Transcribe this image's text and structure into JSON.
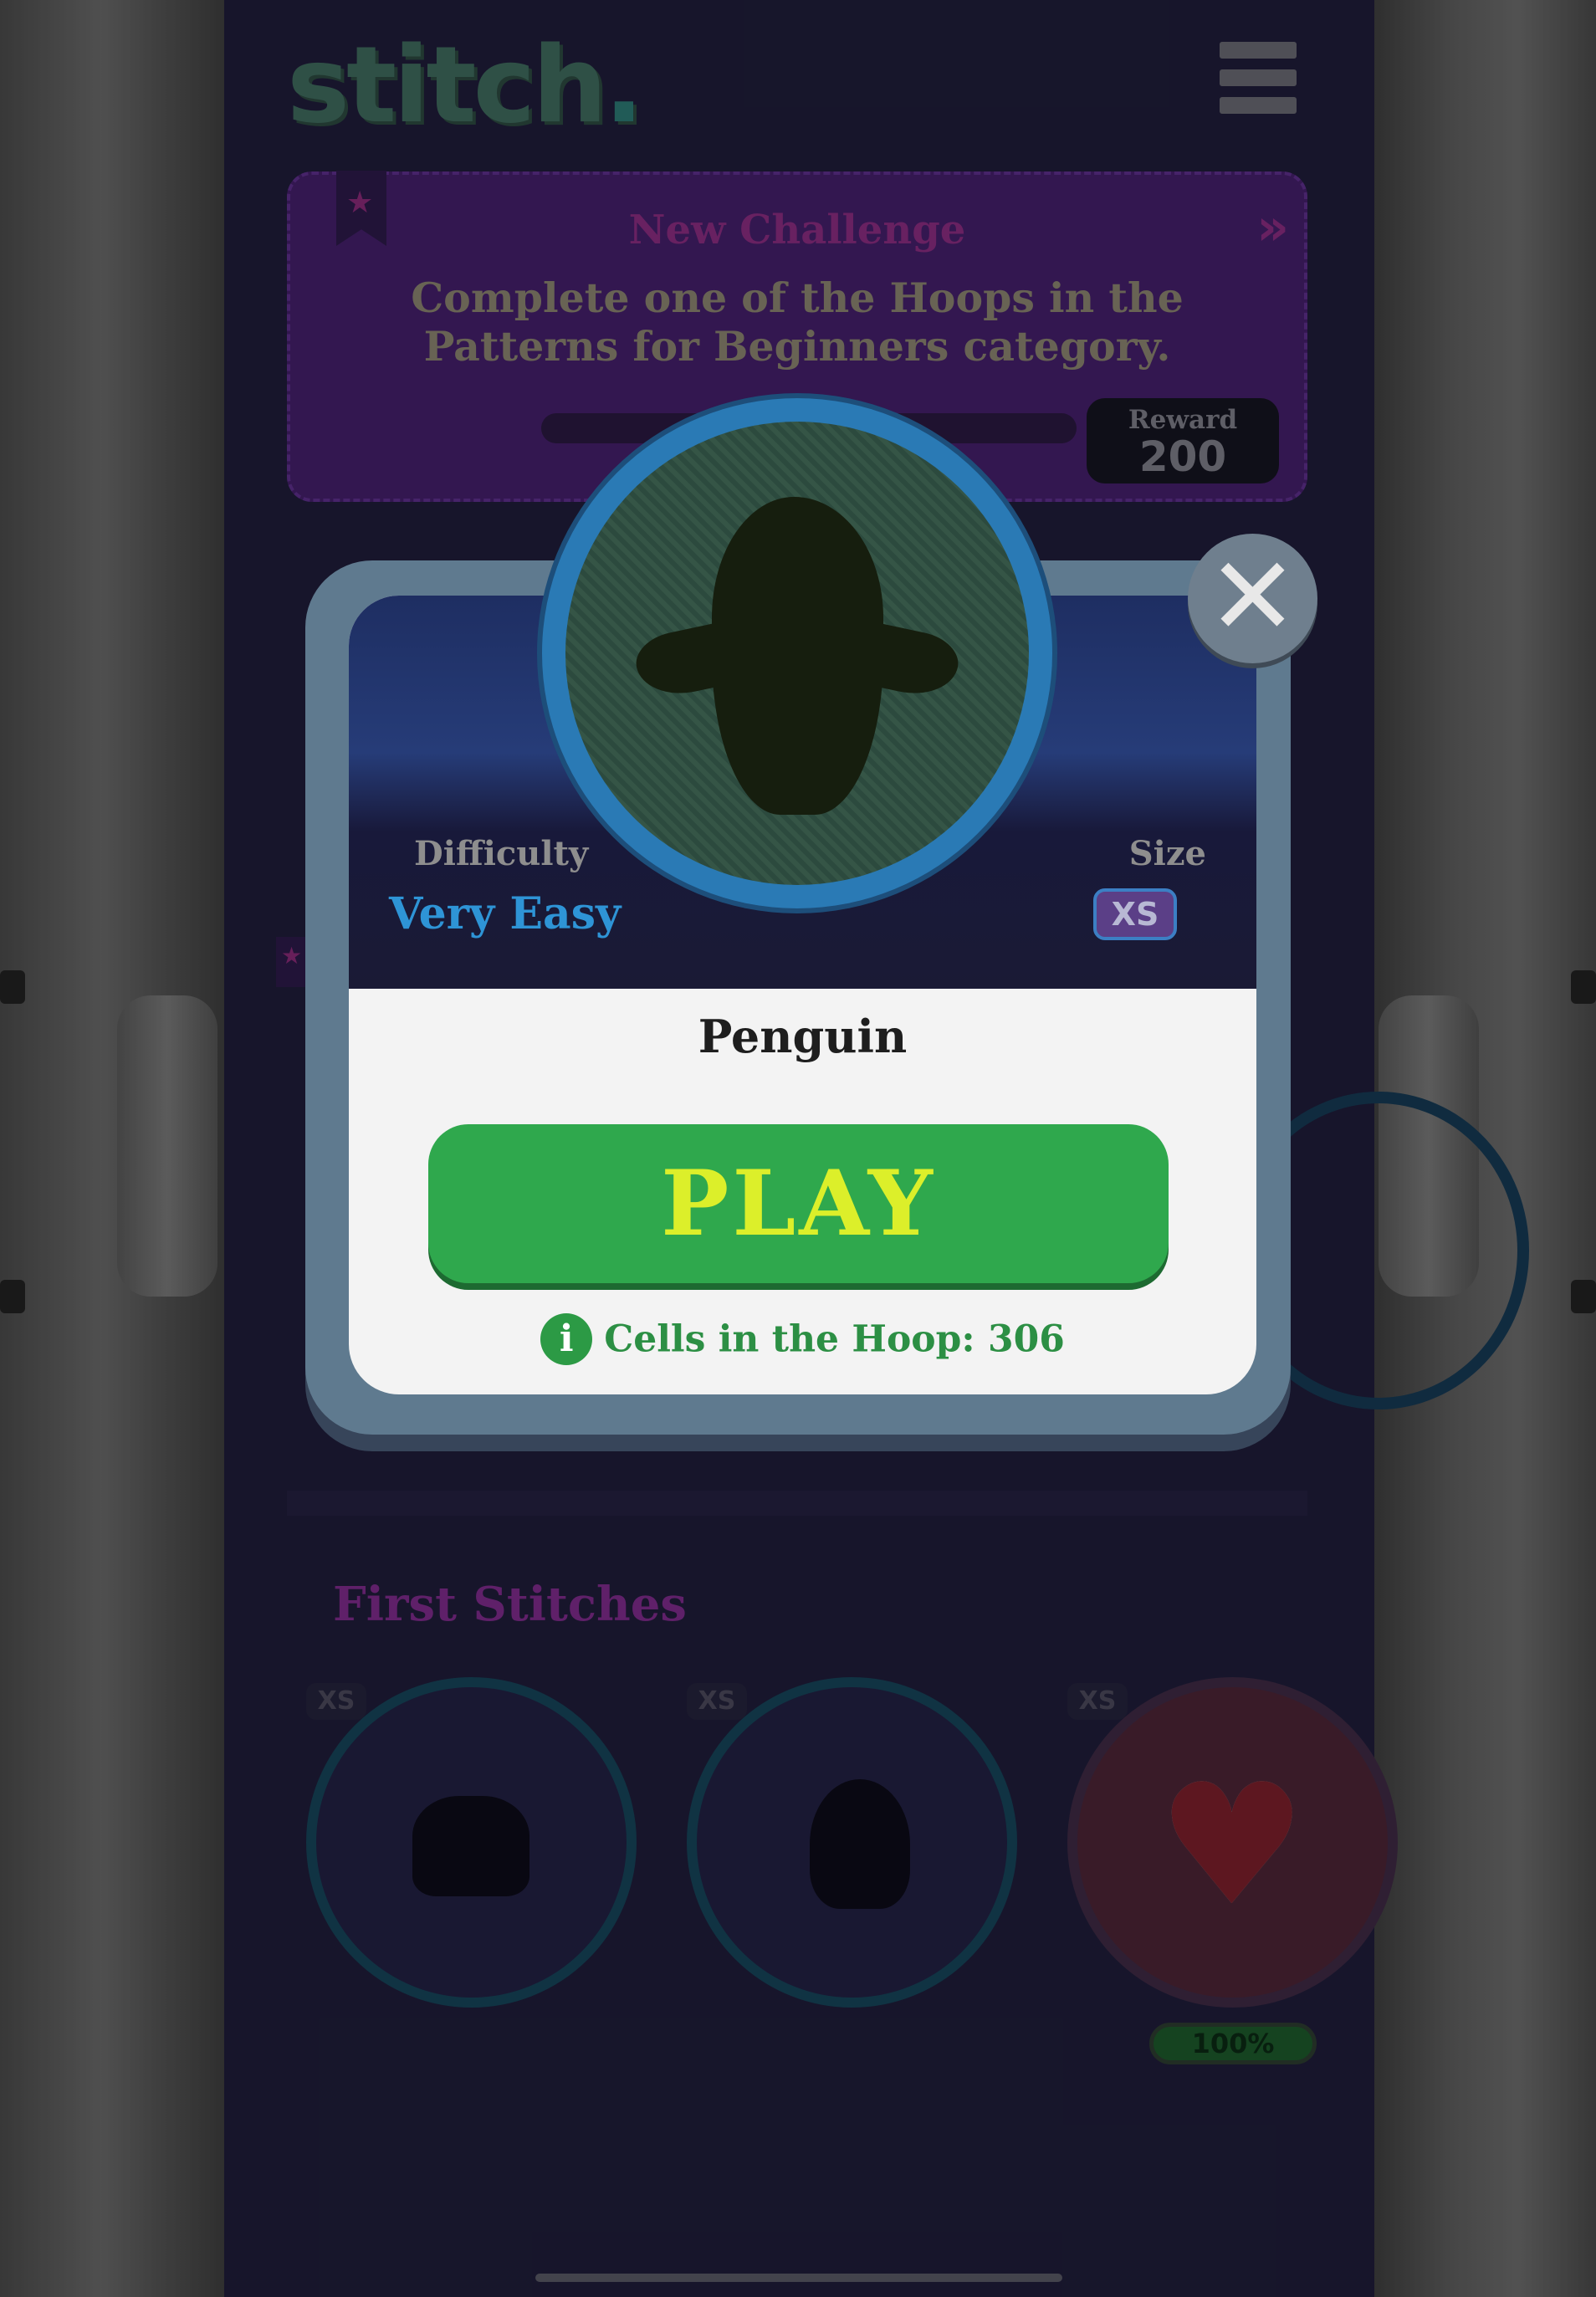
{
  "app": {
    "logo_text": "stitch",
    "logo_dot": "."
  },
  "challenge": {
    "title": "New Challenge",
    "description": "Complete one of the Hoops in the Patterns for Beginners category.",
    "reward_label": "Reward",
    "reward_value": "200"
  },
  "section": {
    "title": "First Stitches"
  },
  "hoops": [
    {
      "size": "XS",
      "icon": "unknown-silhouette"
    },
    {
      "size": "XS",
      "icon": "cupcake-silhouette"
    },
    {
      "size": "XS",
      "icon": "heart-icon",
      "progress_label": "100%",
      "progress": 1.0
    }
  ],
  "modal": {
    "difficulty_label": "Difficulty",
    "difficulty_value": "Very Easy",
    "size_label": "Size",
    "size_value": "XS",
    "pattern_name": "Penguin",
    "play_label": "PLAY",
    "cells_text": "Cells in the Hoop: 306",
    "info_glyph": "i",
    "close_glyph": "✕"
  },
  "colors": {
    "accent_green": "#2fa84d",
    "play_text": "#dcef2a",
    "difficulty_blue": "#2e94d6",
    "challenge_purple": "#451f6b"
  }
}
